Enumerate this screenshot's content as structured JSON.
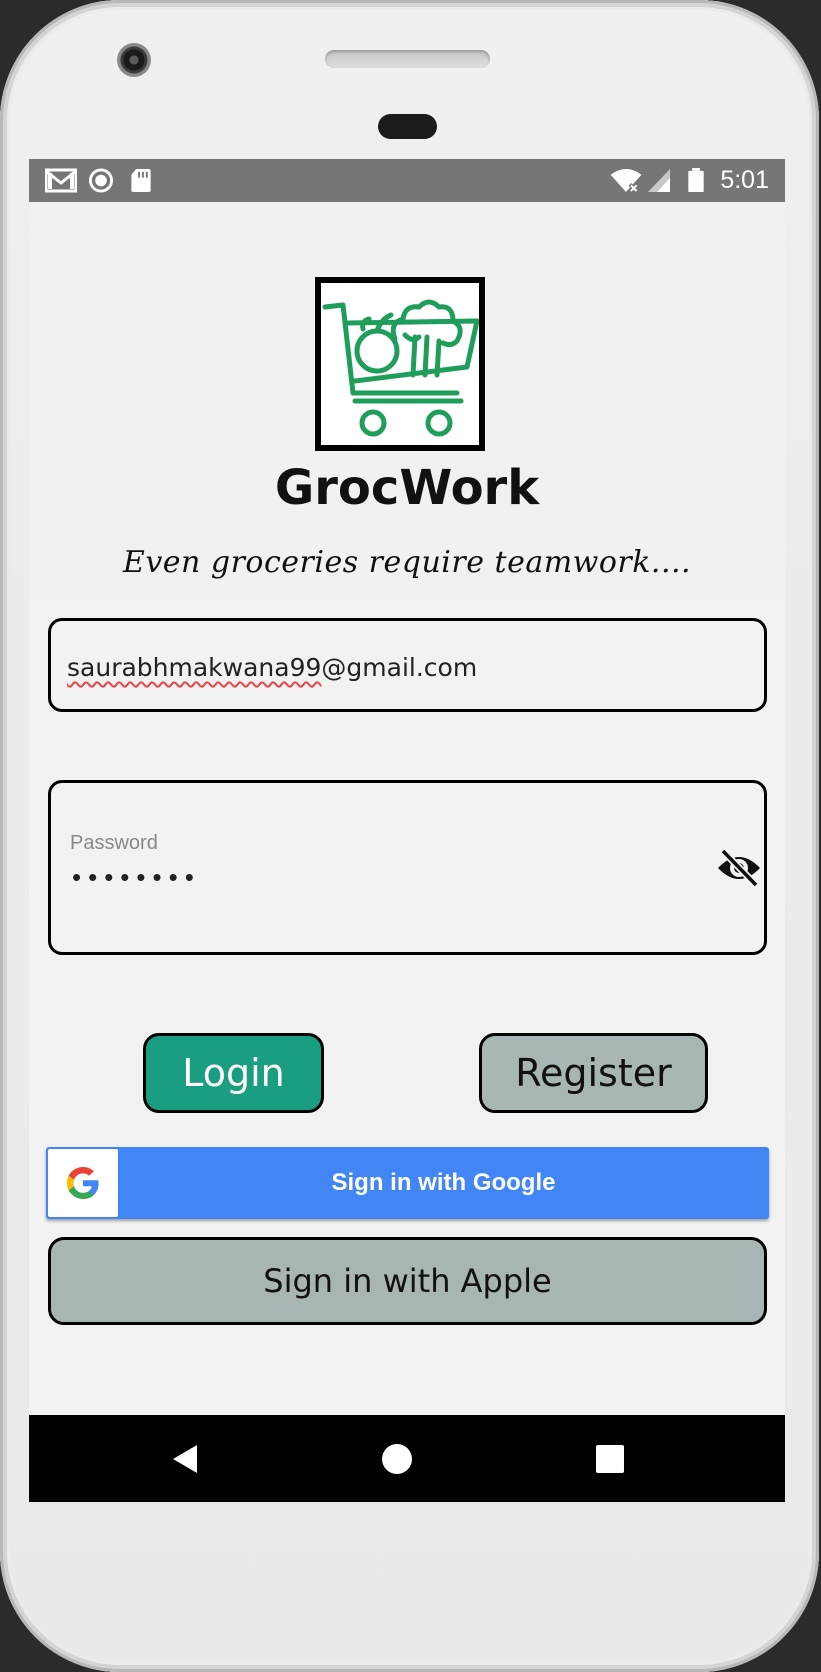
{
  "status_bar": {
    "time": "5:01",
    "left_icons": [
      "gmail-icon",
      "record-icon",
      "sd-card-icon"
    ],
    "right_icons": [
      "wifi-icon",
      "signal-icon",
      "battery-icon"
    ]
  },
  "app": {
    "title": "GrocWork",
    "tagline": "Even groceries require teamwork....",
    "logo_icon": "grocery-cart-logo",
    "brand_green": "#1e9e5a"
  },
  "login_form": {
    "email_value_misspelled": "saurabhmakwana99",
    "email_value_rest": "@gmail.com",
    "password_label": "Password",
    "password_masked": "••••••••",
    "password_visibility_icon": "eye-off-icon"
  },
  "buttons": {
    "login": "Login",
    "register": "Register",
    "google": "Sign in with Google",
    "apple": "Sign in with Apple"
  },
  "colors": {
    "login_bg": "#1a9e82",
    "secondary_bg": "#a8b5b5",
    "google_blue": "#4285f4",
    "status_bar": "#767676"
  },
  "nav_bar": {
    "icons": [
      "back-icon",
      "home-icon",
      "recents-icon"
    ]
  }
}
